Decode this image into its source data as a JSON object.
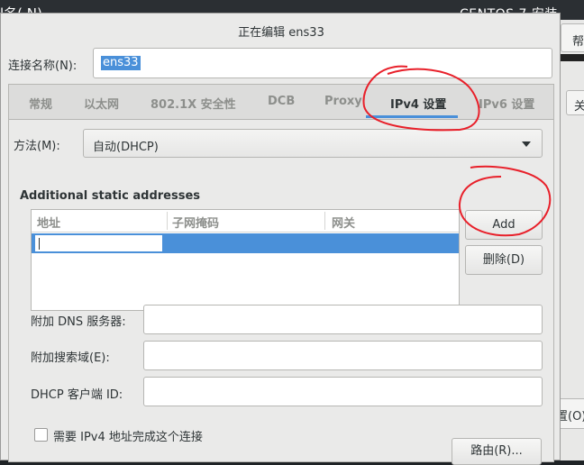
{
  "background": {
    "left_title": "l名( N)",
    "right_title": "CENTOS 7 安装",
    "help_button": "帮",
    "close_button": "关",
    "config_button": "置(O)"
  },
  "dialog": {
    "title": "正在编辑 ens33",
    "connection_name_label": "连接名称(N):",
    "connection_name_value": "ens33"
  },
  "tabs": [
    {
      "label": "常规",
      "active": false
    },
    {
      "label": "以太网",
      "active": false
    },
    {
      "label": "802.1X 安全性",
      "active": false
    },
    {
      "label": "DCB",
      "active": false
    },
    {
      "label": "Proxy",
      "active": false
    },
    {
      "label": "IPv4 设置",
      "active": true
    },
    {
      "label": "IPv6 设置",
      "active": false
    }
  ],
  "ipv4": {
    "method_label": "方法(M):",
    "method_value": "自动(DHCP)",
    "static_title": "Additional static addresses",
    "columns": [
      "地址",
      "子网掩码",
      "网关"
    ],
    "add_button": "Add",
    "delete_button": "删除(D)",
    "dns_label": "附加 DNS 服务器:",
    "search_label": "附加搜索域(E):",
    "dhcp_id_label": "DHCP 客户端 ID:",
    "require_ipv4_label": "需要 IPv4 地址完成这个连接",
    "routes_button": "路由(R)..."
  },
  "colors": {
    "accent": "#4a90d9",
    "annotation": "#e8202a"
  }
}
